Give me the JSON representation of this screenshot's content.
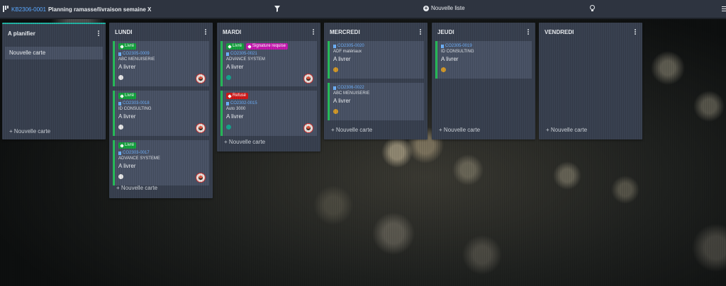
{
  "header": {
    "ref": "KB2306-0001",
    "title": "Planning ramasse/livraison semaine X",
    "new_list_label": "Nouvelle liste",
    "icons": [
      "board-icon",
      "filter-icon",
      "plus-circle-icon",
      "bulb-icon",
      "menu-icon"
    ]
  },
  "colors": {
    "topbar": "#2e3440",
    "list": "#394150",
    "card": "#4a5366",
    "link": "#5aa8ff",
    "tag_green": "#15a33f",
    "tag_magenta": "#c719b1",
    "tag_red": "#d11a1a",
    "dot_white": "#e8e8e8",
    "dot_teal": "#16a68e",
    "dot_amber": "#d49a2a"
  },
  "lists": [
    {
      "title": "A planifier",
      "new_card_label": "Nouvelle carte",
      "add_label": "+ Nouvelle carte"
    },
    {
      "title": "LUNDI",
      "add_label": "+ Nouvelle carte",
      "cards": [
        {
          "tags": [
            "Livré"
          ],
          "ref": "CO2305-0009",
          "company": "ABC MENUISERIE",
          "status": "A livrer",
          "dot": "white"
        },
        {
          "tags": [
            "Livré"
          ],
          "ref": "CO2303-0018",
          "company": "ID CONSULTING",
          "status": "A livrer",
          "dot": "white"
        },
        {
          "tags": [
            "Livré"
          ],
          "ref": "CO2303-0017",
          "company": "ADVANCE SYSTEME",
          "status": "A livrer",
          "dot": "white"
        }
      ]
    },
    {
      "title": "MARDI",
      "add_label": "+ Nouvelle carte",
      "cards": [
        {
          "tags": [
            "Livré",
            "Signature requise"
          ],
          "ref": "CO2305-0021",
          "company": "ADVANCE SYSTEM",
          "status": "A livrer",
          "dot": "teal"
        },
        {
          "tags": [
            "Refusé"
          ],
          "ref": "CO2302-0015",
          "company": "Auto 3000",
          "status": "A livrer",
          "dot": "teal"
        }
      ]
    },
    {
      "title": "MERCREDI",
      "add_label": "+ Nouvelle carte",
      "cards": [
        {
          "ref": "CO2305-0020",
          "company": "ADF matériaux",
          "status": "A livrer",
          "dot": "amber"
        },
        {
          "ref": "CO2306-0022",
          "company": "ABC MENUISERIE",
          "status": "A livrer",
          "dot": "amber"
        }
      ]
    },
    {
      "title": "JEUDI",
      "add_label": "+ Nouvelle carte",
      "cards": [
        {
          "ref": "CO2305-0019",
          "company": "ID CONSULTING",
          "status": "A livrer",
          "dot": "amber"
        }
      ]
    },
    {
      "title": "VENDREDI",
      "add_label": "+ Nouvelle carte"
    }
  ]
}
